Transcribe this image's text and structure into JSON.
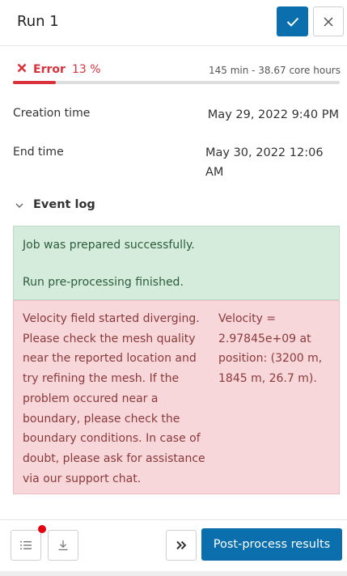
{
  "header": {
    "title": "Run 1",
    "confirm_icon": "check-icon",
    "close_icon": "close-icon"
  },
  "status": {
    "icon": "error-x-icon",
    "label": "Error",
    "percent_text": "13 %",
    "progress_fraction": 0.13,
    "time_summary": "145 min - 38.67 core hours",
    "color": "#d9323c"
  },
  "details": {
    "creation_label": "Creation time",
    "creation_value": "May 29, 2022 9:40 PM",
    "end_label": "End time",
    "end_value": "May 30, 2022 12:06 AM"
  },
  "event_log": {
    "toggle_icon": "chevron-down-icon",
    "label": "Event log",
    "success_messages": [
      "Job was prepared successfully.",
      "Run pre-processing finished."
    ],
    "error_message": "Velocity field started diverging. Please check the mesh quality near the reported location and try refining the mesh. If the problem occured near a boundary, please check the boundary conditions. In case of doubt, please ask for assistance via our support chat.",
    "error_detail": "Velocity = 2.97845e+09 at position: (3200 m, 1845 m, 26.7 m)."
  },
  "footer": {
    "list_icon": "list-icon",
    "download_icon": "download-icon",
    "expand_icon": "double-chevron-right-icon",
    "postprocess_label": "Post-process results"
  },
  "colors": {
    "primary": "#0b6fae",
    "error": "#d9323c",
    "success_bg": "#d5ecdc",
    "error_bg": "#f8d7db",
    "notification": "#e3000f"
  }
}
